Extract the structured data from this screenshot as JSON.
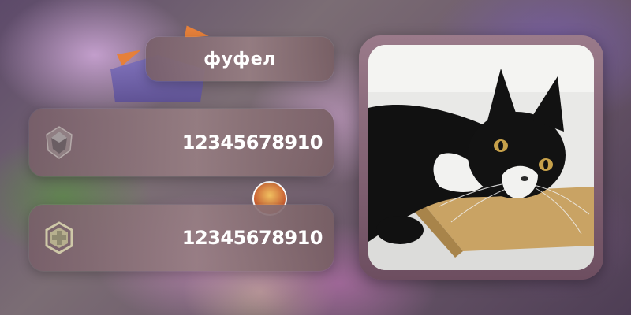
{
  "player": {
    "name": "фуфел"
  },
  "stats": [
    {
      "icon": "crystal-rank-icon",
      "value": "12345678910"
    },
    {
      "icon": "medic-cross-hex-icon",
      "value": "12345678910"
    }
  ],
  "avatar": {
    "icon": "black-white-cat-photo"
  },
  "colors": {
    "panel": "#8f7479",
    "frame": "#8a6a7a",
    "icon": "#cfc8a8"
  }
}
